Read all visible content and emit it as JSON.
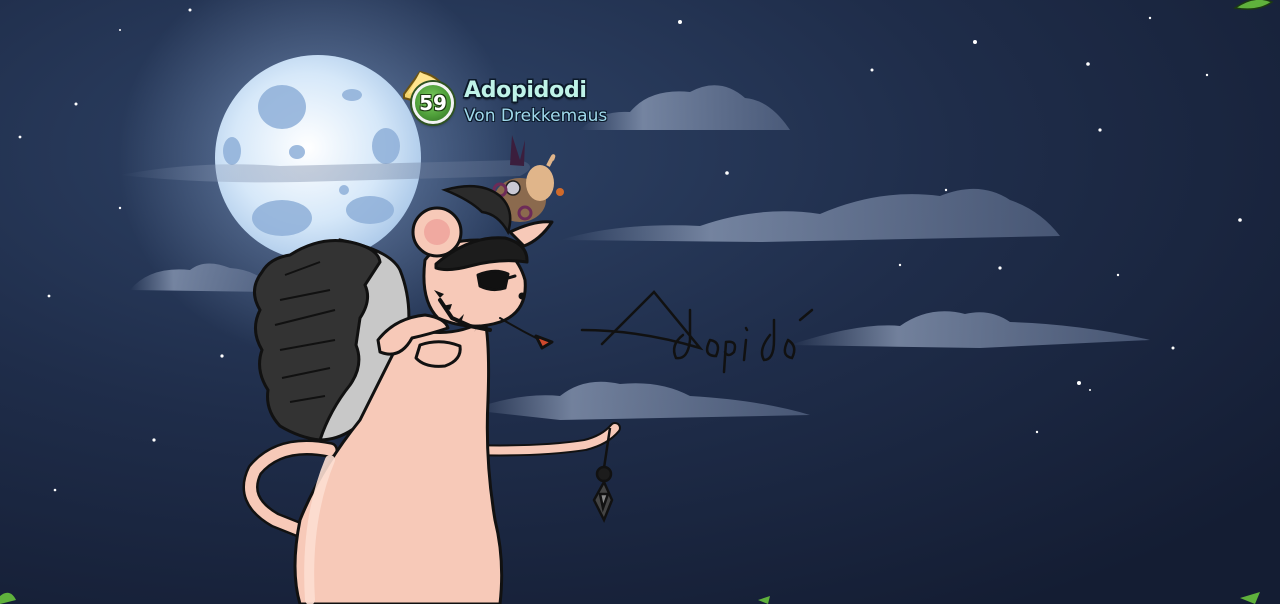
{
  "player": {
    "level": "59",
    "name": "Adopidodi",
    "title": "Von Drekkemaus"
  },
  "signature": "Adopidodi",
  "icons": {
    "level": "cheese-level-icon"
  },
  "colors": {
    "sky": "#1b2740",
    "moon": "#cfe3f6",
    "mouse_body": "#f7c9b8",
    "name_text": "#bff3e8",
    "title_text": "#9fd8ea",
    "badge_green": "#4f9f3a"
  }
}
